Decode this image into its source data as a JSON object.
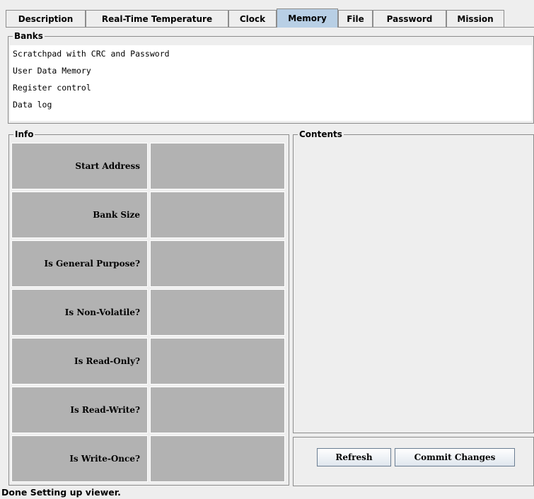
{
  "tabs": [
    {
      "label": "Description",
      "active": false
    },
    {
      "label": "Real-Time Temperature",
      "active": false
    },
    {
      "label": "Clock",
      "active": false
    },
    {
      "label": "Memory",
      "active": true
    },
    {
      "label": "File",
      "active": false
    },
    {
      "label": "Password",
      "active": false
    },
    {
      "label": "Mission",
      "active": false
    }
  ],
  "banks": {
    "title": "Banks",
    "items": [
      "Scratchpad with CRC and Password",
      "User Data Memory",
      "Register control",
      "Data log"
    ]
  },
  "info": {
    "title": "Info",
    "rows": [
      {
        "label": "Start Address",
        "value": ""
      },
      {
        "label": "Bank Size",
        "value": ""
      },
      {
        "label": "Is General Purpose?",
        "value": ""
      },
      {
        "label": "Is Non-Volatile?",
        "value": ""
      },
      {
        "label": "Is Read-Only?",
        "value": ""
      },
      {
        "label": "Is Read-Write?",
        "value": ""
      },
      {
        "label": "Is Write-Once?",
        "value": ""
      }
    ]
  },
  "contents": {
    "title": "Contents"
  },
  "buttons": {
    "refresh": "Refresh",
    "commit": "Commit Changes"
  },
  "status": "Done Setting up viewer.",
  "colors": {
    "active_tab": "#b8cfe5",
    "cell_bg": "#b2b2b2",
    "window_bg": "#eeeeee"
  }
}
